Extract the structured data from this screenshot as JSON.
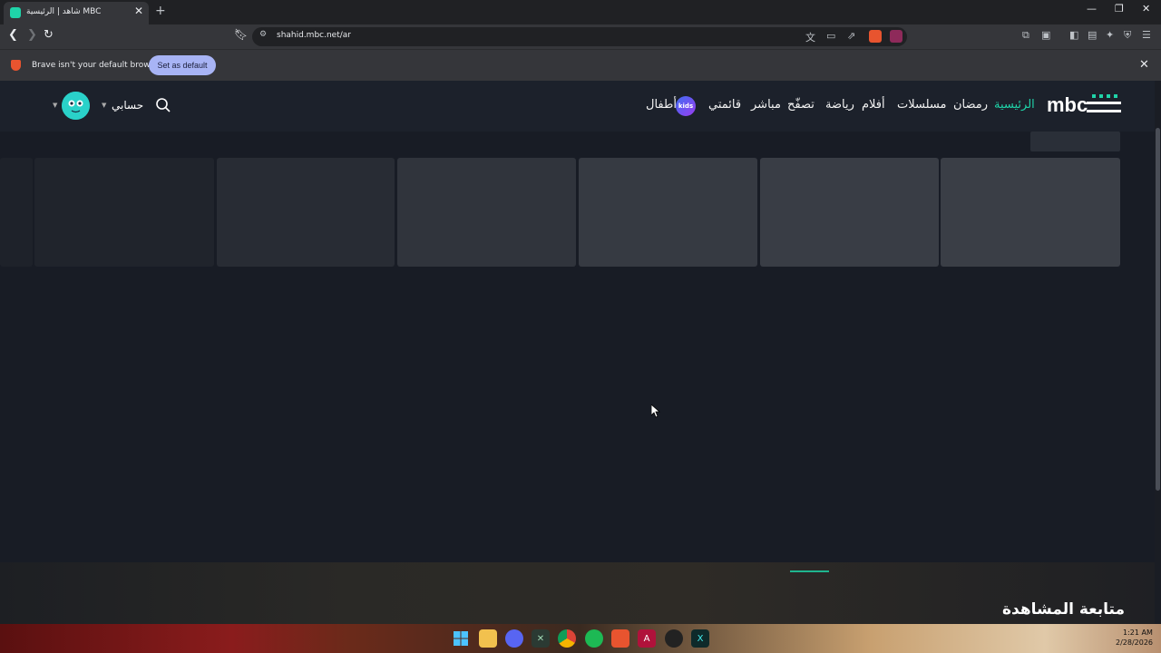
{
  "browser": {
    "tab_title": "شاهد | الرئيسية MBC",
    "url": "shahid.mbc.net/ar",
    "infobar_text": "Brave isn't your default browser",
    "set_default_label": "Set as default"
  },
  "site": {
    "logo_text": "mbc",
    "nav": [
      {
        "label": "الرئيسية",
        "active": true
      },
      {
        "label": "رمضان"
      },
      {
        "label": "مسلسلات"
      },
      {
        "label": "أفلام"
      },
      {
        "label": "رياضة"
      },
      {
        "label": "تصفّح"
      },
      {
        "label": "مباشر"
      },
      {
        "label": "قائمتي"
      },
      {
        "label": "أطفال"
      }
    ],
    "kids_badge": "kids",
    "account_label": "حسابي",
    "continue_watching": "متابعة المشاهدة",
    "colors": {
      "accent": "#1fd3a8",
      "background": "#181c25",
      "header": "#1c212b"
    }
  },
  "taskbar": {
    "time": "1:21 AM",
    "date": "2/28/2026"
  }
}
